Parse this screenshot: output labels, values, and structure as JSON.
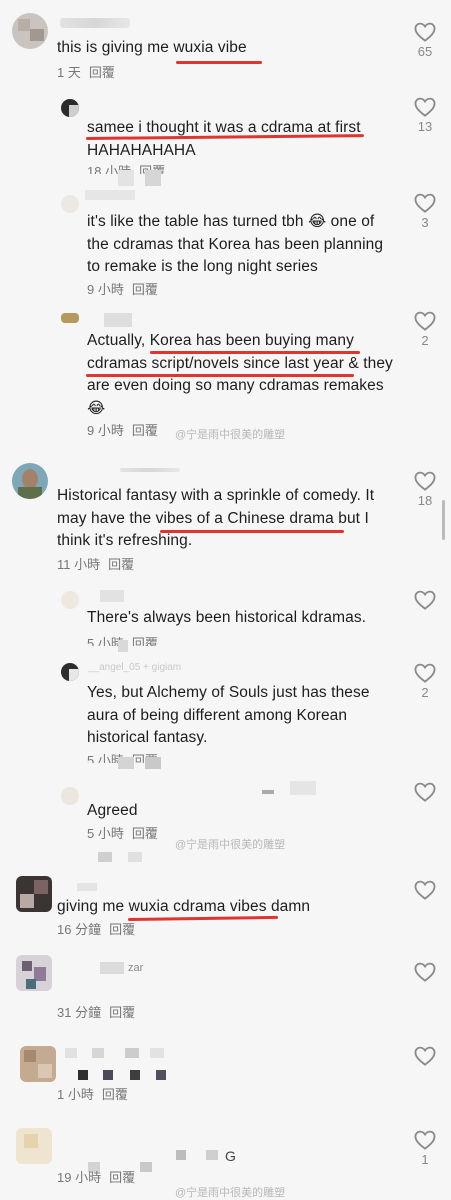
{
  "comments": [
    {
      "text": "this is giving me wuxia vibe",
      "time": "1 天",
      "reply": "回覆",
      "likes": "65"
    },
    {
      "text": "samee i thought it was a cdrama at first HAHAHAHAHA",
      "time": "18 小時",
      "reply": "回覆",
      "likes": "13"
    },
    {
      "text": "it's like the table has turned tbh 😂 one of the cdramas that Korea has been planning to remake is the long night series",
      "time": "9 小時",
      "reply": "回覆",
      "likes": "3"
    },
    {
      "text": "Actually, Korea has been buying many cdramas script/novels since last year & they are even doing so many cdramas remakes 😂",
      "time": "9 小時",
      "reply": "回覆",
      "likes": "2"
    },
    {
      "text": "Historical fantasy with a sprinkle of comedy. It may have the vibes of a Chinese drama but I think it's refreshing.",
      "time": "11 小時",
      "reply": "回覆",
      "likes": "18"
    },
    {
      "text": "There's always been historical kdramas.",
      "time": "5 小時",
      "reply": "回覆",
      "likes": ""
    },
    {
      "text": "Yes, but Alchemy of Souls just has these aura of being different among Korean historical fantasy.",
      "time": "5 小時",
      "reply": "回覆",
      "likes": "2"
    },
    {
      "text": "Agreed",
      "time": "5 小時",
      "reply": "回覆",
      "likes": ""
    },
    {
      "text": "giving me wuxia cdrama vibes damn",
      "time": "16 分鐘",
      "reply": "回覆",
      "likes": ""
    },
    {
      "text": "zar",
      "time": "31 分鐘",
      "reply": "回覆",
      "likes": ""
    },
    {
      "text": "",
      "time": "1 小時",
      "reply": "回覆",
      "likes": ""
    },
    {
      "text": "G",
      "time": "19 小時",
      "reply": "回覆",
      "likes": "1"
    }
  ],
  "partial_username": "__angel_05 + gigiam",
  "watermark": "@宁是雨中很美的雕塑",
  "colors": {
    "underline": "#e0342e",
    "background": "#f6f6f6"
  },
  "icons": {
    "like": "heart-outline-icon"
  }
}
